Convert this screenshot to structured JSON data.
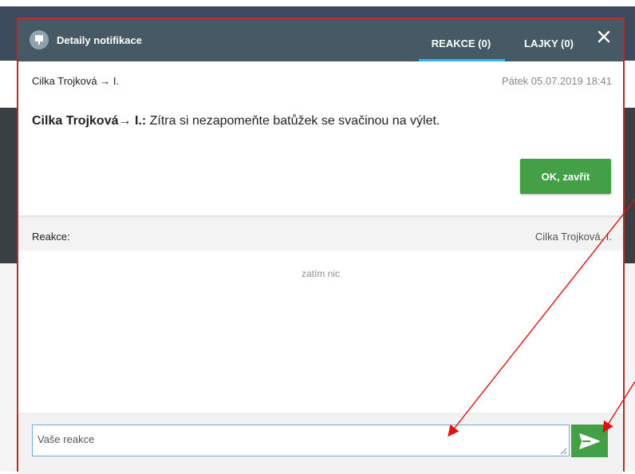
{
  "modal": {
    "title": "Detaily notifikace",
    "icon": "notification-icon",
    "tabs": [
      {
        "label": "REAKCE (0)",
        "active": true
      },
      {
        "label": "LAJKY (0)",
        "active": false
      }
    ],
    "close_icon": "close-icon"
  },
  "notification": {
    "route": "Cilka Trojková → I.",
    "timestamp": "Pátek 05.07.2019 18:41",
    "message_sender": "Cilka Trojková→ I.:",
    "message_text": " Zítra si nezapomeňte batůžek se svačinou na výlet.",
    "ok_button": "OK, zavřít"
  },
  "reactions": {
    "label": "Reakce:",
    "author": "Cilka Trojková, I.",
    "empty_text": "zatím nic",
    "input_placeholder": "Vaše reakce",
    "send_icon": "send-icon"
  },
  "colors": {
    "header": "#455a64",
    "accent_green": "#43a047",
    "tab_underline": "#29b6f6",
    "annotation_red": "#b92a2a"
  }
}
